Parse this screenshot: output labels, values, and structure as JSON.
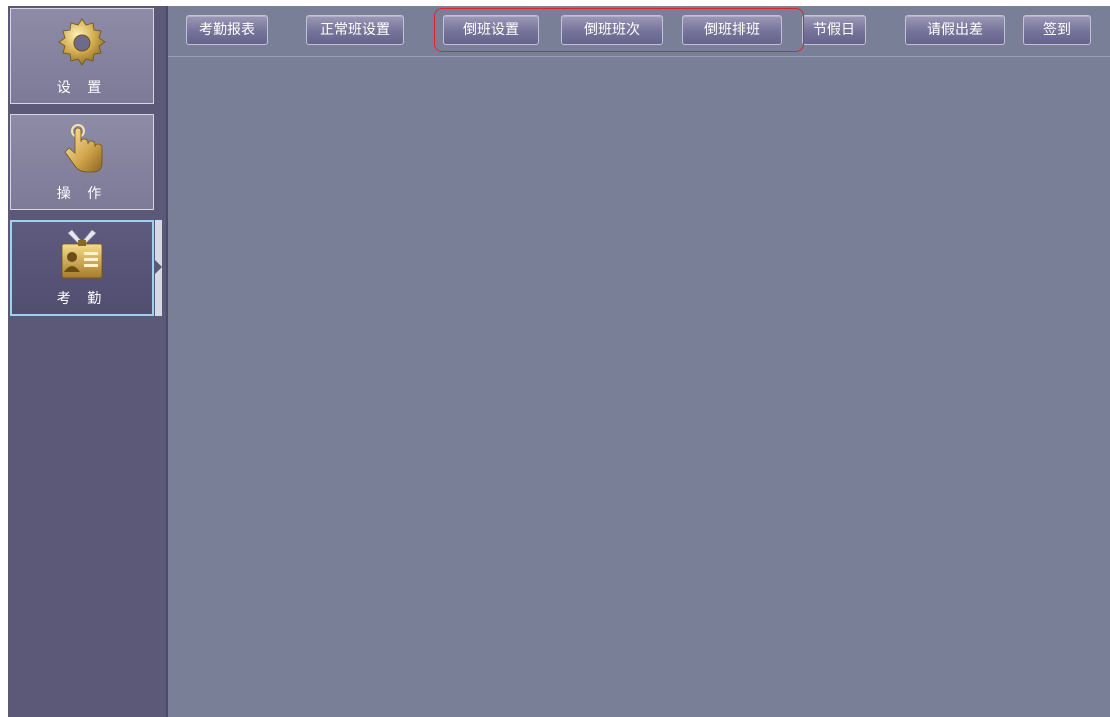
{
  "sidebar": {
    "items": [
      {
        "label": "设 置",
        "icon": "gear-icon",
        "active": false
      },
      {
        "label": "操 作",
        "icon": "hand-pointer-icon",
        "active": false
      },
      {
        "label": "考 勤",
        "icon": "id-card-icon",
        "active": true
      }
    ]
  },
  "toolbar": {
    "buttons": [
      {
        "label": "考勤报表"
      },
      {
        "label": "正常班设置"
      },
      {
        "label": "倒班设置"
      },
      {
        "label": "倒班班次"
      },
      {
        "label": "倒班排班"
      },
      {
        "label": "节假日"
      },
      {
        "label": "请假出差"
      },
      {
        "label": "签到"
      }
    ]
  },
  "colors": {
    "content_bg": "#7a7f98",
    "sidebar_bg": "#5c5978",
    "highlight": "#e0242c",
    "active_border": "#9fd0ef",
    "icon_gold": "#c9a54a"
  }
}
